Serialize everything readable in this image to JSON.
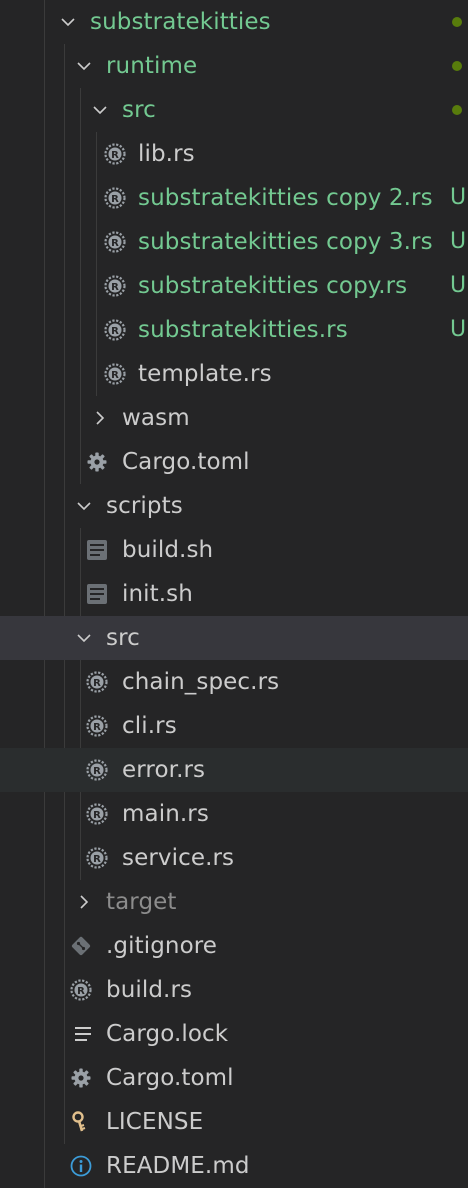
{
  "explorer": {
    "items": [
      {
        "label": "substratekitties",
        "kind": "folder-open",
        "icon": "chevron-down-icon",
        "status": "dot"
      },
      {
        "label": "runtime",
        "kind": "folder-open",
        "icon": "chevron-down-icon",
        "status": "dot"
      },
      {
        "label": "src",
        "kind": "folder-open",
        "icon": "chevron-down-icon",
        "status": "dot"
      },
      {
        "label": "lib.rs",
        "kind": "file",
        "icon": "rust-file-icon"
      },
      {
        "label": "substratekitties copy 2.rs",
        "kind": "file",
        "icon": "rust-file-icon",
        "status": "U"
      },
      {
        "label": "substratekitties copy 3.rs",
        "kind": "file",
        "icon": "rust-file-icon",
        "status": "U"
      },
      {
        "label": "substratekitties copy.rs",
        "kind": "file",
        "icon": "rust-file-icon",
        "status": "U"
      },
      {
        "label": "substratekitties.rs",
        "kind": "file",
        "icon": "rust-file-icon",
        "status": "U"
      },
      {
        "label": "template.rs",
        "kind": "file",
        "icon": "rust-file-icon"
      },
      {
        "label": "wasm",
        "kind": "folder-closed",
        "icon": "chevron-right-icon"
      },
      {
        "label": "Cargo.toml",
        "kind": "file",
        "icon": "gear-icon"
      },
      {
        "label": "scripts",
        "kind": "folder-open",
        "icon": "chevron-down-icon"
      },
      {
        "label": "build.sh",
        "kind": "file",
        "icon": "shell-script-icon"
      },
      {
        "label": "init.sh",
        "kind": "file",
        "icon": "shell-script-icon"
      },
      {
        "label": "src",
        "kind": "folder-open",
        "icon": "chevron-down-icon",
        "selected": true
      },
      {
        "label": "chain_spec.rs",
        "kind": "file",
        "icon": "rust-file-icon"
      },
      {
        "label": "cli.rs",
        "kind": "file",
        "icon": "rust-file-icon"
      },
      {
        "label": "error.rs",
        "kind": "file",
        "icon": "rust-file-icon",
        "hovered": true
      },
      {
        "label": "main.rs",
        "kind": "file",
        "icon": "rust-file-icon"
      },
      {
        "label": "service.rs",
        "kind": "file",
        "icon": "rust-file-icon"
      },
      {
        "label": "target",
        "kind": "folder-closed",
        "icon": "chevron-right-icon",
        "ignored": true
      },
      {
        "label": ".gitignore",
        "kind": "file",
        "icon": "git-icon"
      },
      {
        "label": "build.rs",
        "kind": "file",
        "icon": "rust-file-icon"
      },
      {
        "label": "Cargo.lock",
        "kind": "file",
        "icon": "lines-icon"
      },
      {
        "label": "Cargo.toml",
        "kind": "file",
        "icon": "gear-icon"
      },
      {
        "label": "LICENSE",
        "kind": "file",
        "icon": "key-icon"
      },
      {
        "label": "README.md",
        "kind": "file",
        "icon": "info-icon"
      }
    ]
  },
  "colors": {
    "background": "#252526",
    "text": "#cccccc",
    "untracked": "#73c991",
    "modified_dot": "#587c0c",
    "ignored": "#8c8c8c",
    "selected_row": "#37373d",
    "hover_row": "#2a2d2e",
    "info_icon": "#3c9cd8",
    "key_icon": "#e2c08d"
  }
}
